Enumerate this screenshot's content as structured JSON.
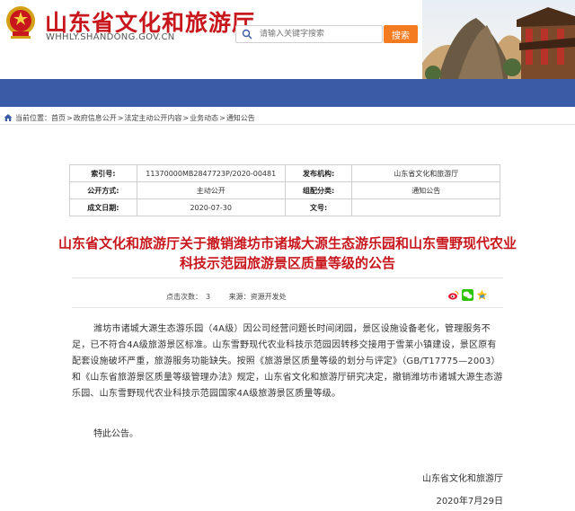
{
  "header": {
    "site_title": "山东省文化和旅游厅",
    "site_url": "WHHLY.SHANDONG.GOV.CN",
    "search": {
      "placeholder": "请输入关键字搜索",
      "button_label": "搜索"
    }
  },
  "breadcrumb": {
    "label": "当前位置：",
    "items": [
      "首页",
      "政府信息公开",
      "法定主动公开内容",
      "业务动态",
      "通知公告"
    ]
  },
  "meta": {
    "index_label": "索引号:",
    "index_value": "11370000MB2847723P/2020-00481",
    "publisher_label": "发布机构:",
    "publisher_value": "山东省文化和旅游厅",
    "disclosure_label": "公开方式:",
    "disclosure_value": "主动公开",
    "category_label": "组配分类:",
    "category_value": "通知公告",
    "date_label": "成文日期:",
    "date_value": "2020-07-30",
    "docno_label": "文号:",
    "docno_value": ""
  },
  "article": {
    "title": "山东省文化和旅游厅关于撤销潍坊市诸城大源生态游乐园和山东雪野现代农业科技示范园旅游景区质量等级的公告",
    "clicks_label": "点击次数：",
    "clicks_value": "3",
    "source_label": "来源：",
    "source_value": "资源开发处",
    "body": "潍坊市诸城大源生态游乐园（4A级）因公司经营问题长时间闭园，景区设施设备老化，管理服务不足，已不符合4A级旅游景区标准。山东雪野现代农业科技示范园因转移交接用于雪莱小镇建设，景区原有配套设施破坏严重，旅游服务功能缺失。按照《旅游景区质量等级的划分与评定》（GB/T17775—2003）和《山东省旅游景区质量等级管理办法》规定，山东省文化和旅游厅研究决定，撤销潍坊市诸城大源生态游乐园、山东雪野现代农业科技示范园国家4A级旅游景区质量等级。",
    "closing": "特此公告。",
    "signature": "山东省文化和旅游厅",
    "date": "2020年7月29日"
  },
  "colors": {
    "brand_red": "#c8161d",
    "nav_blue": "#3a5ba5",
    "search_orange": "#f47b20"
  },
  "icons": [
    "emblem",
    "search-icon",
    "home-icon",
    "weibo-icon",
    "wechat-icon",
    "qzone-icon"
  ]
}
